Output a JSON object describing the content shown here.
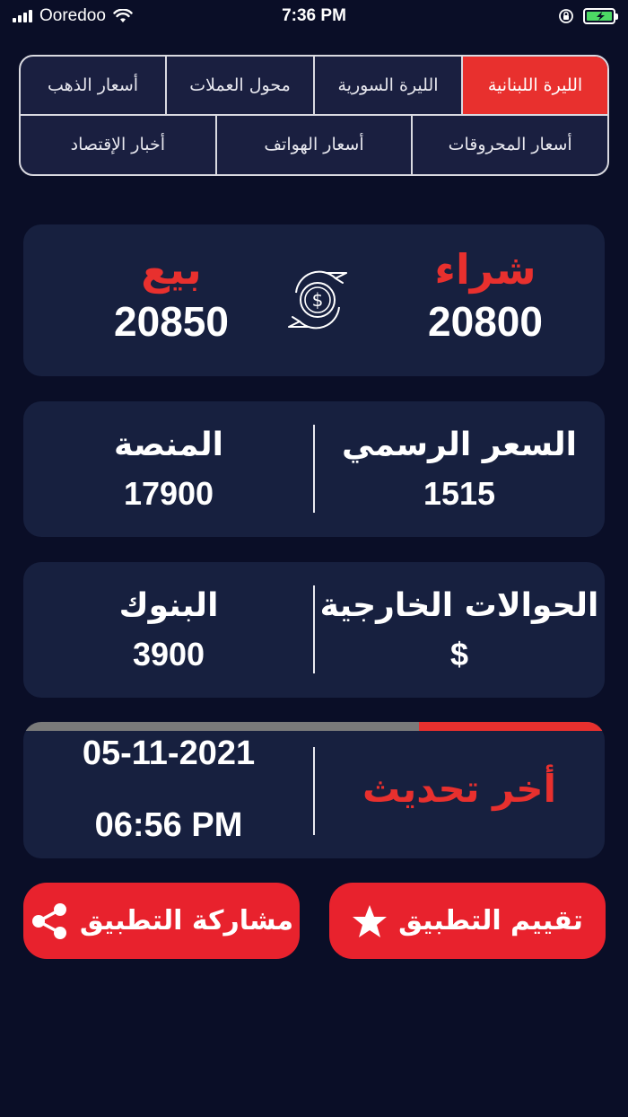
{
  "status_bar": {
    "carrier": "Ooredoo",
    "time": "7:36 PM"
  },
  "tabs": {
    "top": [
      {
        "label": "الليرة اللبنانية",
        "active": true
      },
      {
        "label": "الليرة السورية",
        "active": false
      },
      {
        "label": "محول العملات",
        "active": false
      },
      {
        "label": "أسعار الذهب",
        "active": false
      }
    ],
    "bottom": [
      {
        "label": "أسعار المحروقات"
      },
      {
        "label": "أسعار الهواتف"
      },
      {
        "label": "أخبار الإقتصاد"
      }
    ]
  },
  "rates": {
    "buy_label": "شراء",
    "buy_value": "20800",
    "sell_label": "بيع",
    "sell_value": "20850"
  },
  "official": {
    "official_label": "السعر  الرسمي",
    "official_value": "1515",
    "platform_label": "المنصة",
    "platform_value": "17900"
  },
  "transfers": {
    "transfers_label": "الحوالات الخارجية",
    "transfers_value": "$",
    "banks_label": "البنوك",
    "banks_value": "3900"
  },
  "update": {
    "label": "أخر  تحديث",
    "date": "05-11-2021",
    "time": "06:56 PM",
    "progress_fraction": 0.32
  },
  "buttons": {
    "rate_label": "تقييم التطبيق",
    "share_label": "مشاركة التطبيق"
  },
  "colors": {
    "background": "#0a0e27",
    "card": "#17203f",
    "accent_red": "#e8302e",
    "text": "#ffffff"
  },
  "icons": {
    "exchange": "dollar-exchange-icon",
    "star": "star-icon",
    "share": "share-icon"
  }
}
